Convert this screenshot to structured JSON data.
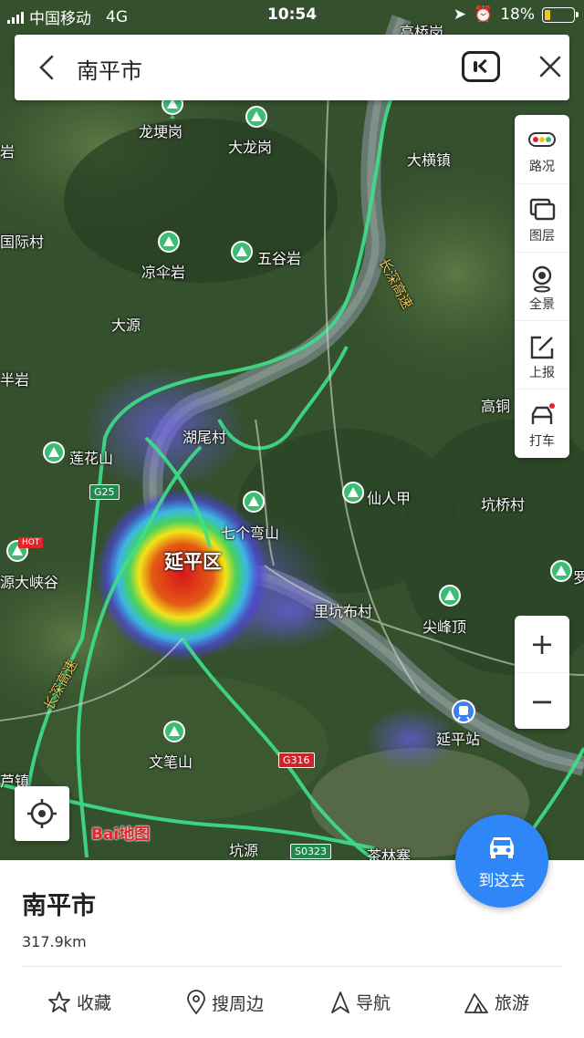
{
  "status_bar": {
    "carrier": "中国移动",
    "network": "4G",
    "time": "10:54",
    "battery_percent": "18%"
  },
  "search": {
    "query": "南平市"
  },
  "tools": {
    "traffic": "路况",
    "layers": "图层",
    "panorama": "全景",
    "report": "上报",
    "taxi": "打车"
  },
  "zoom": {
    "plus": "+",
    "minus": "−"
  },
  "map": {
    "logo": "Bai地图",
    "labels": {
      "longgenggang": "龙埂岗",
      "dalonggang": "大龙岗",
      "dahengzhen": "大横镇",
      "gaoqiao": "高桥岗",
      "liangsanyan": "凉伞岩",
      "wuguyan": "五谷岩",
      "dayuan": "大源",
      "huweicun": "湖尾村",
      "lianhuashan": "莲花山",
      "xianrenjia": "仙人甲",
      "qiqiaocun": "坑桥村",
      "qigewanshan": "七个弯山",
      "yanpingqu": "延平区",
      "likengbucun": "里坑布村",
      "jianfengding": "尖峰顶",
      "yanpingzhan": "延平站",
      "wenbishan": "文笔山",
      "kengyuan": "坑源",
      "chalinzhai": "茶林寨",
      "luzhen": "芦镇",
      "dayuanxiagu": "源大峡谷",
      "gaotong": "高铜",
      "left_guoji": "国际村",
      "left_ya": "岩",
      "left_banyan": "半岩",
      "right_luo": "罗"
    },
    "roads": {
      "g25": "G25",
      "g316": "G316",
      "s0323": "S0323",
      "hot": "HOT",
      "expressway": "长深高速"
    }
  },
  "goto_button": "到这去",
  "place": {
    "name": "南平市",
    "distance": "317.9km"
  },
  "actions": {
    "favorite": "收藏",
    "nearby": "搜周边",
    "navigate": "导航",
    "travel": "旅游"
  }
}
